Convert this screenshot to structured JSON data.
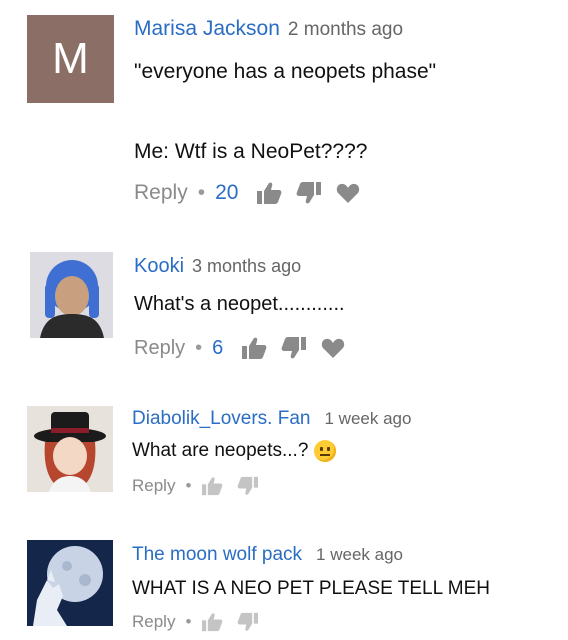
{
  "comments": [
    {
      "author": "Marisa Jackson",
      "time": "2 months ago",
      "avatar_letter": "M",
      "lines": [
        "\"everyone has a neopets phase\"",
        "Me: Wtf is a NeoPet????"
      ],
      "reply_label": "Reply",
      "separator": "•",
      "likes": "20"
    },
    {
      "author": "Kooki",
      "time": "3 months ago",
      "lines": [
        "What's a neopet............"
      ],
      "reply_label": "Reply",
      "separator": "•",
      "likes": "6"
    },
    {
      "author": "Diabolik_Lovers. Fan",
      "time": "1 week ago",
      "lines": [
        "What are neopets...?"
      ],
      "reply_label": "Reply",
      "separator": "•",
      "likes": ""
    },
    {
      "author": "The moon wolf pack",
      "time": "1 week ago",
      "lines": [
        "WHAT IS A NEO PET PLEASE TELL MEH"
      ],
      "reply_label": "Reply",
      "separator": "•",
      "likes": ""
    }
  ],
  "icons": [
    "thumbs-up-icon",
    "thumbs-down-icon",
    "heart-icon",
    "smiley-emoji-icon"
  ],
  "colors": {
    "author": "#2a6dc4",
    "muted": "#8a8a8a",
    "avatar_m": "#8b6f66"
  }
}
